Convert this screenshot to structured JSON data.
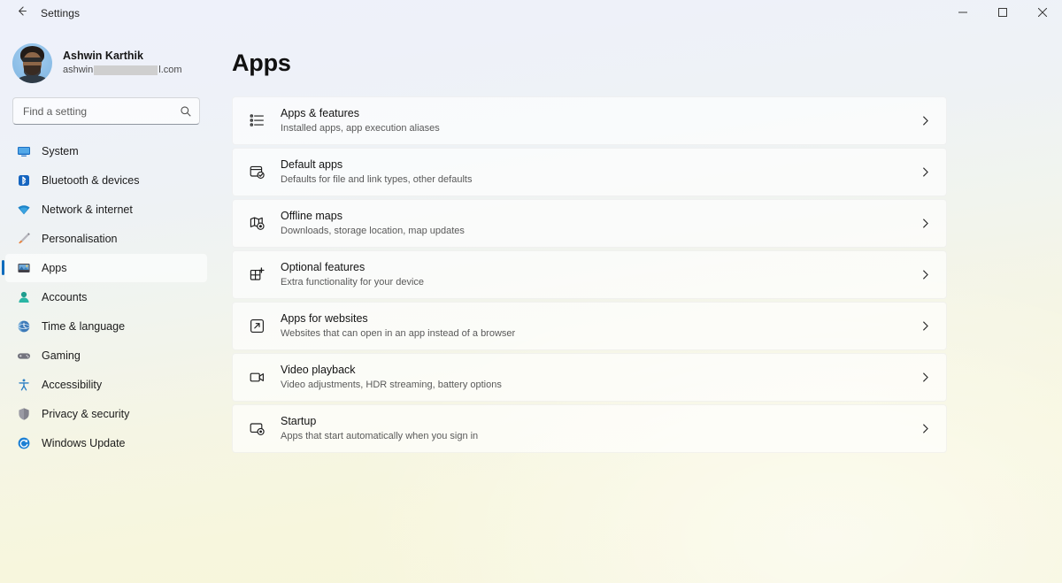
{
  "window": {
    "title": "Settings",
    "back_icon": "back-arrow-icon",
    "minimize_label": "Minimise",
    "maximize_label": "Maximise",
    "close_label": "Close"
  },
  "profile": {
    "name": "Ashwin Karthik",
    "email_prefix": "ashwin",
    "email_suffix": "l.com",
    "avatar_alt": "Ashwin Karthik"
  },
  "search": {
    "placeholder": "Find a setting",
    "value": "",
    "icon": "search-icon"
  },
  "sidebar": {
    "items": [
      {
        "label": "System",
        "icon": "monitor-icon",
        "active": false
      },
      {
        "label": "Bluetooth & devices",
        "icon": "bluetooth-icon",
        "active": false
      },
      {
        "label": "Network & internet",
        "icon": "wifi-icon",
        "active": false
      },
      {
        "label": "Personalisation",
        "icon": "paintbrush-icon",
        "active": false
      },
      {
        "label": "Apps",
        "icon": "apps-icon",
        "active": true
      },
      {
        "label": "Accounts",
        "icon": "person-icon",
        "active": false
      },
      {
        "label": "Time & language",
        "icon": "globe-clock-icon",
        "active": false
      },
      {
        "label": "Gaming",
        "icon": "gamepad-icon",
        "active": false
      },
      {
        "label": "Accessibility",
        "icon": "accessibility-icon",
        "active": false
      },
      {
        "label": "Privacy & security",
        "icon": "shield-icon",
        "active": false
      },
      {
        "label": "Windows Update",
        "icon": "update-icon",
        "active": false
      }
    ]
  },
  "main": {
    "page_title": "Apps",
    "cards": [
      {
        "title": "Apps & features",
        "subtitle": "Installed apps, app execution aliases",
        "icon": "list-bullets-icon"
      },
      {
        "title": "Default apps",
        "subtitle": "Defaults for file and link types, other defaults",
        "icon": "default-apps-icon"
      },
      {
        "title": "Offline maps",
        "subtitle": "Downloads, storage location, map updates",
        "icon": "map-pin-icon"
      },
      {
        "title": "Optional features",
        "subtitle": "Extra functionality for your device",
        "icon": "grid-plus-icon"
      },
      {
        "title": "Apps for websites",
        "subtitle": "Websites that can open in an app instead of a browser",
        "icon": "external-link-icon"
      },
      {
        "title": "Video playback",
        "subtitle": "Video adjustments, HDR streaming, battery options",
        "icon": "video-camera-icon"
      },
      {
        "title": "Startup",
        "subtitle": "Apps that start automatically when you sign in",
        "icon": "startup-icon"
      }
    ],
    "chevron_icon": "chevron-right-icon"
  },
  "colors": {
    "accent": "#0f6cbd",
    "bg_top": "#eef1f9",
    "bg_bottom": "#f6f5db",
    "card_bg": "#ffffff",
    "text_primary": "#131313",
    "text_secondary": "#595959"
  }
}
